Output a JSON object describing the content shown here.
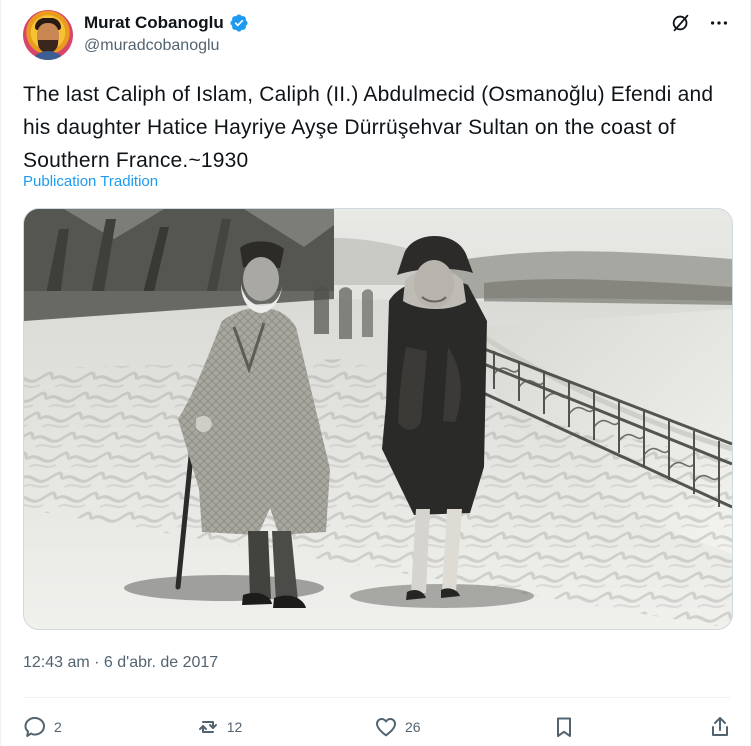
{
  "author": {
    "display_name": "Murat Cobanoglu",
    "handle": "@muradcobanoglu",
    "verified": true,
    "avatar_name": "profile-avatar"
  },
  "header_icons": {
    "grok": "grok-icon",
    "more": "more-icon"
  },
  "tweet": {
    "text": "The last Caliph of Islam, Caliph (II.) Abdulmecid (Osmanoğlu) Efendi and his daughter Hatice Hayriye Ayşe Dürrüşehvar Sultan on the coast of Southern France.~1930",
    "translation_link": "Publication Tradition",
    "timestamp": "12:43 am · 6 d'abr. de 2017"
  },
  "media": {
    "description_hidden": "",
    "tone": "sepia"
  },
  "actions": {
    "reply_count": "2",
    "repost_count": "12",
    "like_count": "26",
    "bookmark_label": "",
    "share_label": ""
  },
  "colors": {
    "accent": "#1d9bf0",
    "text": "#0f1419",
    "secondary_text": "#536471",
    "border": "#cfd9de"
  }
}
